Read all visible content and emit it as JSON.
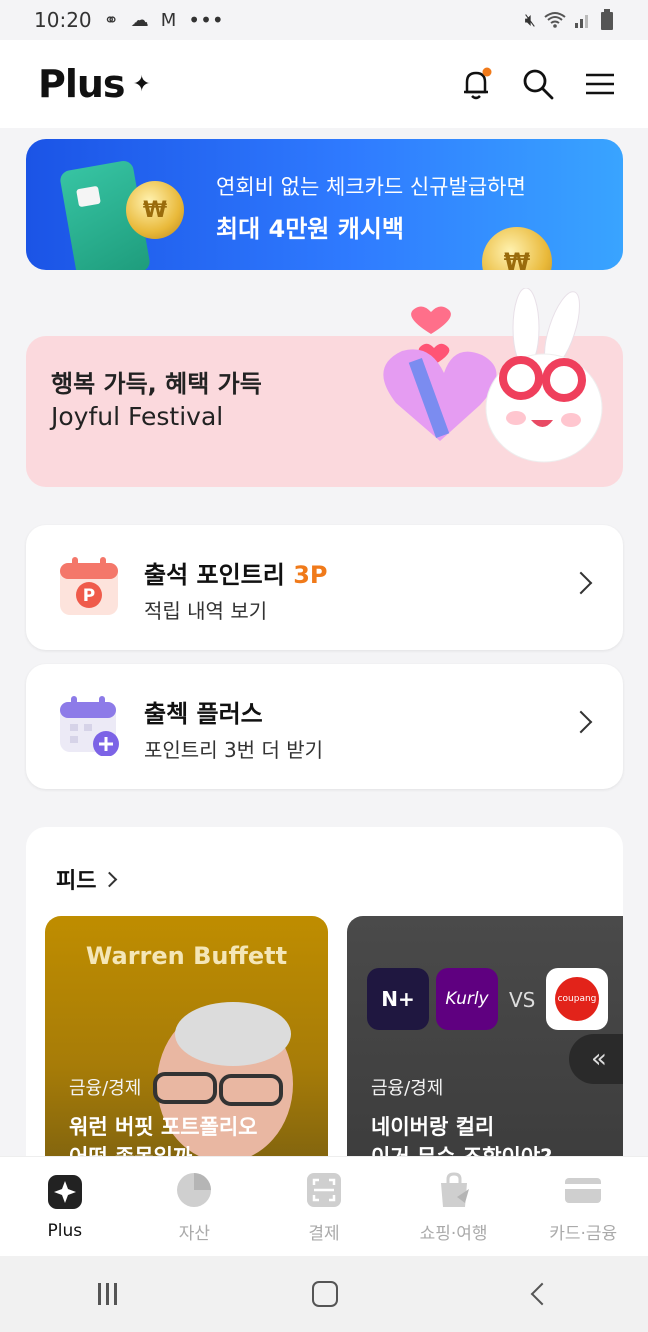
{
  "status_bar": {
    "time": "10:20",
    "more": "•••"
  },
  "header": {
    "logo_text": "Plus",
    "logo_mark": "✦"
  },
  "banner": {
    "line1": "연회비 없는 체크카드 신규발급하면",
    "line2": "최대 4만원 캐시백"
  },
  "festival": {
    "title": "행복 가득, 혜택 가득",
    "subtitle": "Joyful Festival"
  },
  "attendance": {
    "title": "출석 포인트리",
    "points": "3P",
    "subtitle": "적립 내역 보기",
    "icon_letter": "P"
  },
  "check_plus": {
    "title": "출첵 플러스",
    "subtitle": "포인트리 3번 더 받기"
  },
  "feed": {
    "title": "피드",
    "cards": [
      {
        "image_text": "Warren Buffett",
        "category": "금융/경제",
        "title": "워런 버핏 포트폴리오\n어떤 종목일까"
      },
      {
        "category": "금융/경제",
        "title": "네이버랑 컬리\n이거 무슨 조합이야?",
        "logo1": "N+",
        "logo2": "Kurly",
        "vs": "VS",
        "logo3": "coupang"
      }
    ]
  },
  "bottom_nav": [
    {
      "label": "Plus",
      "icon": "plus-sparkle-icon",
      "active": true
    },
    {
      "label": "자산",
      "icon": "pie-chart-icon",
      "active": false
    },
    {
      "label": "결제",
      "icon": "scan-icon",
      "active": false
    },
    {
      "label": "쇼핑·여행",
      "icon": "shopping-bag-icon",
      "active": false
    },
    {
      "label": "카드·금융",
      "icon": "card-icon",
      "active": false
    }
  ],
  "colors": {
    "accent": "#f07a1a",
    "banner": "#2f7bff",
    "festival_bg": "#fbd9dd"
  }
}
